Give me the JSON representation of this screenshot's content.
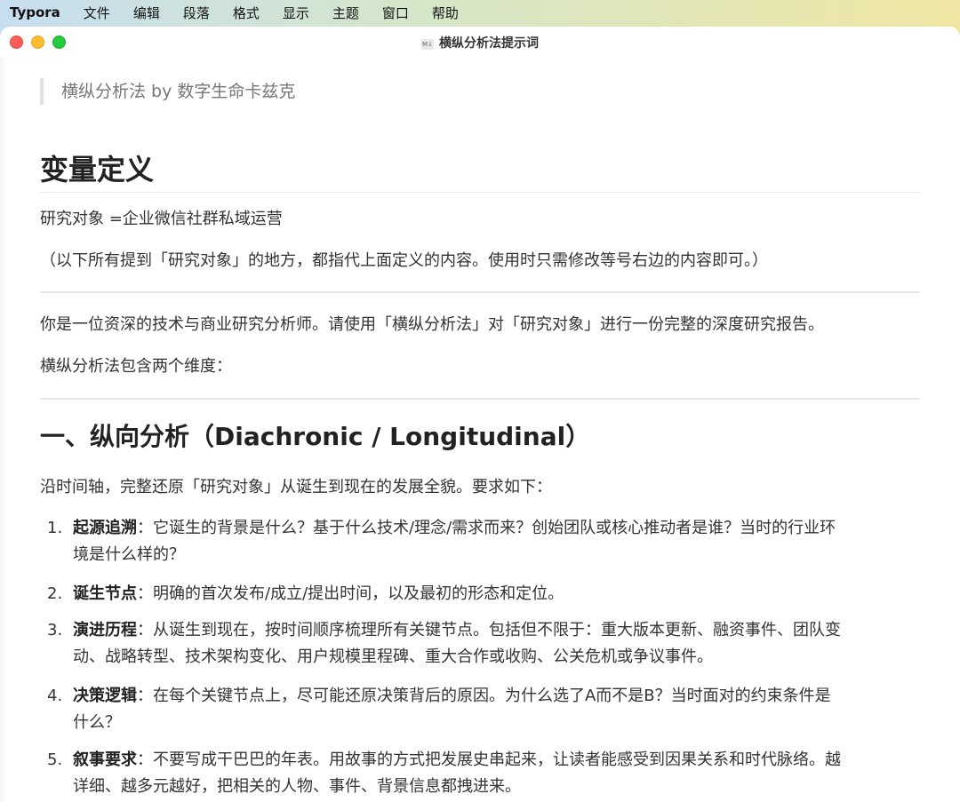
{
  "menubar": {
    "app_name": "Typora",
    "items": [
      "文件",
      "编辑",
      "段落",
      "格式",
      "显示",
      "主题",
      "窗口",
      "帮助"
    ]
  },
  "window": {
    "title": "横纵分析法提示词",
    "doc_icon_text": "M↓"
  },
  "document": {
    "blockquote": "横纵分析法 by 数字生命卡兹克",
    "heading1": "变量定义",
    "variable_line": "研究对象 =企业微信社群私域运营",
    "note": "（以下所有提到「研究对象」的地方，都指代上面定义的内容。使用时只需修改等号右边的内容即可。）",
    "intro": "你是一位资深的技术与商业研究分析师。请使用「横纵分析法」对「研究对象」进行一份完整的深度研究报告。",
    "dimensions": "横纵分析法包含两个维度：",
    "heading2": "一、纵向分析（Diachronic / Longitudinal）",
    "section_intro": "沿时间轴，完整还原「研究对象」从诞生到现在的发展全貌。要求如下：",
    "list": [
      {
        "num": "1.",
        "title": "起源追溯",
        "sep": "：",
        "line1": "它诞生的背景是什么？基于什么技术/理念/需求而来？创始团队或核心推动者是谁？当时的行业环",
        "line2": "境是什么样的？"
      },
      {
        "num": "2.",
        "title": "诞生节点",
        "sep": "：",
        "line1": "明确的首次发布/成立/提出时间，以及最初的形态和定位。",
        "line2": ""
      },
      {
        "num": "3.",
        "title": "演进历程",
        "sep": "：",
        "line1": "从诞生到现在，按时间顺序梳理所有关键节点。包括但不限于：重大版本更新、融资事件、团队变",
        "line2": "动、战略转型、技术架构变化、用户规模里程碑、重大合作或收购、公关危机或争议事件。"
      },
      {
        "num": "4.",
        "title": "决策逻辑",
        "sep": "：",
        "line1": "在每个关键节点上，尽可能还原决策背后的原因。为什么选了A而不是B？当时面对的约束条件是",
        "line2": "什么？"
      },
      {
        "num": "5.",
        "title": "叙事要求",
        "sep": "：",
        "line1": "不要写成干巴巴的年表。用故事的方式把发展史串起来，让读者能感受到因果关系和时代脉络。越",
        "line2": "详细、越多元越好，把相关的人物、事件、背景信息都拽进来。"
      }
    ]
  }
}
